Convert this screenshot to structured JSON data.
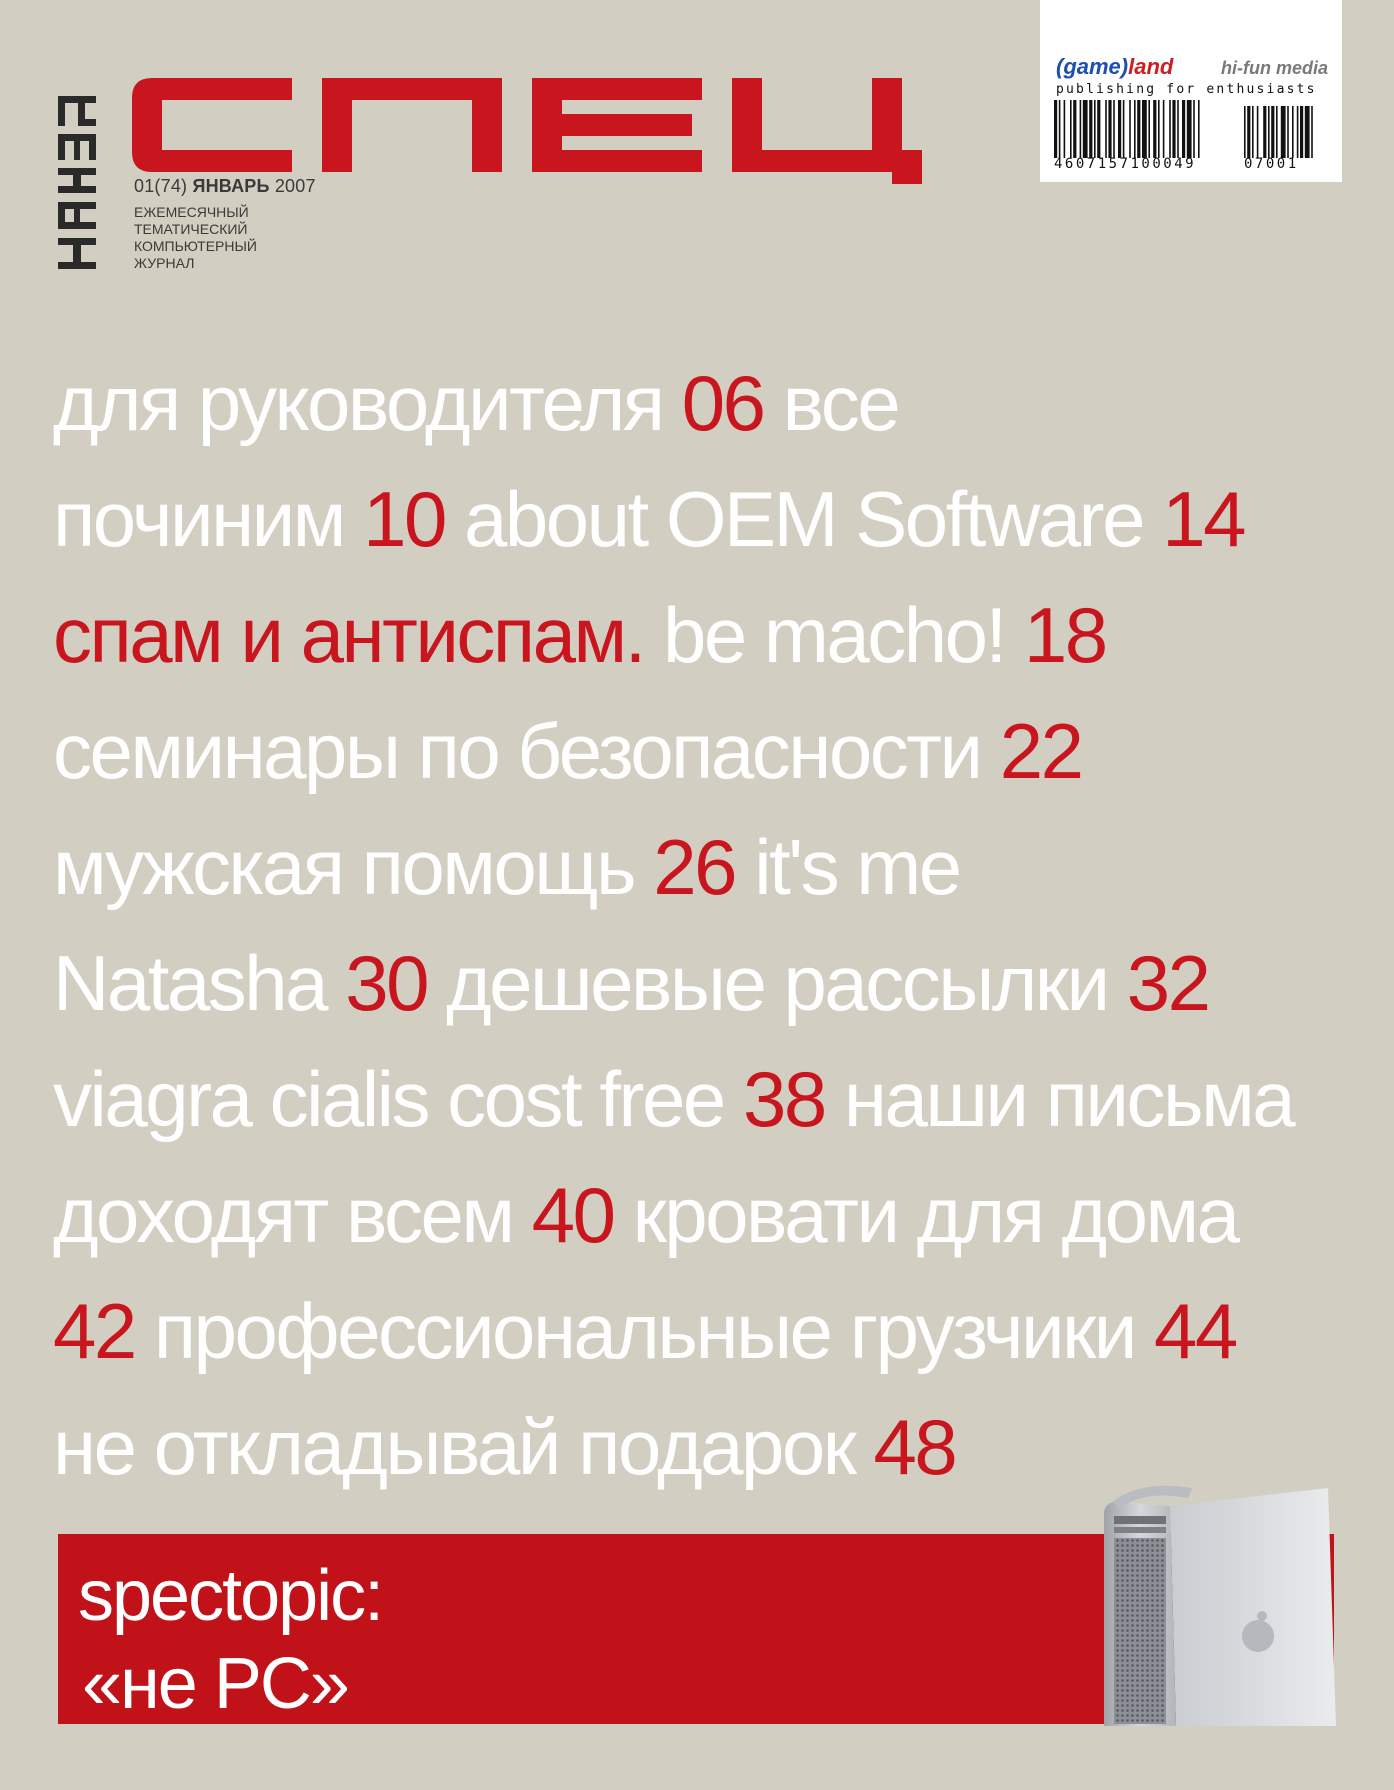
{
  "masthead": {
    "vertical_logo": "ХАКЕР",
    "logo": "СПЕЦ",
    "issue_number": "01(74)",
    "issue_month": "ЯНВАРЬ",
    "issue_year": "2007",
    "tagline": [
      "ЕЖЕМЕСЯЧНЫЙ",
      "ТЕМАТИЧЕСКИЙ",
      "КОМПЬЮТЕРНЫЙ",
      "ЖУРНАЛ"
    ]
  },
  "barcode": {
    "brand_open": "(game)",
    "brand_close": "land",
    "partner": "hi-fun media",
    "slogan": "publishing for enthusiasts",
    "number_main": "4607157100049",
    "number_addon": "07001"
  },
  "contents": {
    "lines": [
      [
        {
          "t": "для руководителя ",
          "c": "w"
        },
        {
          "t": "06",
          "c": "r"
        },
        {
          "t": " все",
          "c": "w"
        }
      ],
      [
        {
          "t": "починим ",
          "c": "w"
        },
        {
          "t": "10",
          "c": "r"
        },
        {
          "t": " about OEM Software ",
          "c": "w"
        },
        {
          "t": "14",
          "c": "r"
        }
      ],
      [
        {
          "t": "спам и антиспам.",
          "c": "r"
        },
        {
          "t": " be macho! ",
          "c": "w"
        },
        {
          "t": "18",
          "c": "r"
        }
      ],
      [
        {
          "t": "семинары по безопасности ",
          "c": "w"
        },
        {
          "t": "22",
          "c": "r"
        }
      ],
      [
        {
          "t": "мужская помощь ",
          "c": "w"
        },
        {
          "t": "26",
          "c": "r"
        },
        {
          "t": " it's me",
          "c": "w"
        }
      ],
      [
        {
          "t": "Natasha ",
          "c": "w"
        },
        {
          "t": "30",
          "c": "r"
        },
        {
          "t": " дешевые рассылки ",
          "c": "w"
        },
        {
          "t": "32",
          "c": "r"
        }
      ],
      [
        {
          "t": "viagra cialis cost free ",
          "c": "w"
        },
        {
          "t": "38",
          "c": "r"
        },
        {
          "t": " наши письма",
          "c": "w"
        }
      ],
      [
        {
          "t": "доходят всем ",
          "c": "w"
        },
        {
          "t": "40",
          "c": "r"
        },
        {
          "t": " кровати для дома",
          "c": "w"
        }
      ],
      [
        {
          "t": "42",
          "c": "r"
        },
        {
          "t": " профессиональные грузчики ",
          "c": "w"
        },
        {
          "t": "44",
          "c": "r"
        }
      ],
      [
        {
          "t": "не откладывай подарок ",
          "c": "w"
        },
        {
          "t": "48",
          "c": "r"
        }
      ]
    ]
  },
  "spectopic": {
    "title": "spectopic:",
    "subtitle": "«не PC»"
  },
  "colors": {
    "background": "#d2cec2",
    "accent_red": "#c8151e",
    "text_white": "#ffffff"
  }
}
